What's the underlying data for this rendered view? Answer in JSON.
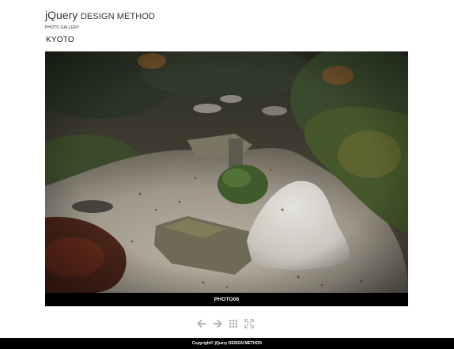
{
  "header": {
    "brand_script": "jQuery",
    "brand_rest": "DESIGN METHOD",
    "subtitle": "PHOTO GALLERY"
  },
  "gallery": {
    "album_title": "KYOTO",
    "current_photo": {
      "caption": "PHOTO06",
      "alt": "PHOTO06"
    }
  },
  "controls": {
    "icons": [
      "arrow-left-icon",
      "arrow-right-icon",
      "grid-icon",
      "fullscreen-icon"
    ],
    "icon_color": "#b3b3b3"
  },
  "footer": {
    "copyright": "Copyright© jQuery DESIGN METHOD"
  },
  "colors": {
    "background": "#ffffff",
    "bar": "#000000",
    "text": "#333333"
  }
}
